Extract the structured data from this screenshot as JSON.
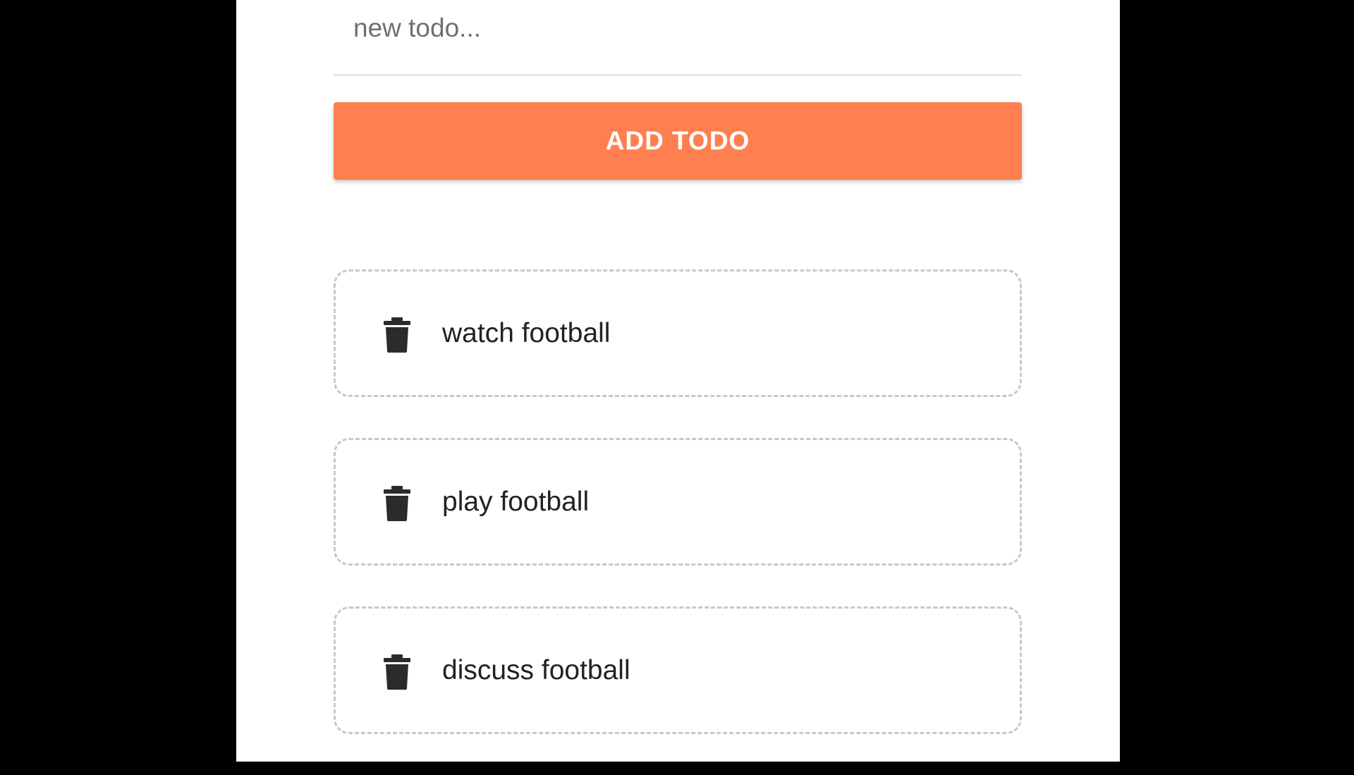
{
  "input": {
    "placeholder": "new todo...",
    "value": ""
  },
  "add_button": {
    "label": "ADD TODO"
  },
  "colors": {
    "accent": "#ff7f50",
    "background": "#000000",
    "panel": "#ffffff"
  },
  "todos": [
    {
      "text": "watch football",
      "icon": "trash-icon"
    },
    {
      "text": "play football",
      "icon": "trash-icon"
    },
    {
      "text": "discuss football",
      "icon": "trash-icon"
    }
  ]
}
